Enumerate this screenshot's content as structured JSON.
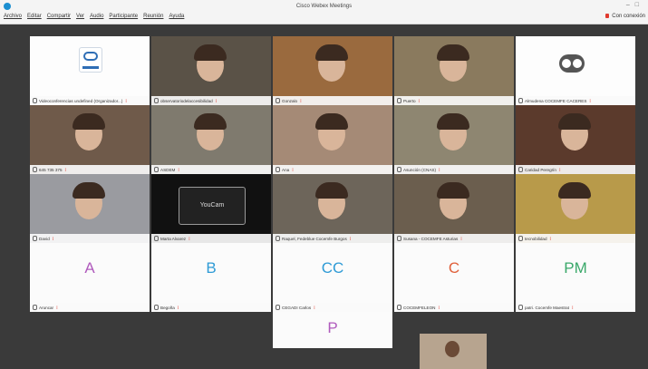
{
  "window": {
    "title": "Cisco Webex Meetings",
    "connection": "Con conexión"
  },
  "menu": [
    "Archivo",
    "Editar",
    "Compartir",
    "Ver",
    "Audio",
    "Participante",
    "Reunión",
    "Ayuda"
  ],
  "participants": [
    {
      "name": "Videoconferencias undefined (Organizador...)",
      "type": "logo"
    },
    {
      "name": "observatoriodelaccesibilidad",
      "type": "video",
      "bg": "#5a5247"
    },
    {
      "name": "Gonzalo",
      "type": "video",
      "bg": "#9a6a3e"
    },
    {
      "name": "Puerto",
      "type": "video",
      "bg": "#8a7a5e"
    },
    {
      "name": "Almudena COCEMFE CACERES",
      "type": "toggle"
    },
    {
      "name": "645 735 375",
      "type": "video",
      "bg": "#6f5a4a"
    },
    {
      "name": "ASDEM",
      "type": "video",
      "bg": "#7f7a6e"
    },
    {
      "name": "Ana",
      "type": "video",
      "bg": "#a58a76"
    },
    {
      "name": "Asunción (CNAS)",
      "type": "video",
      "bg": "#8e8671"
    },
    {
      "name": "Caridad Peregrín",
      "type": "video",
      "bg": "#5b3a2c"
    },
    {
      "name": "David",
      "type": "video",
      "bg": "#9a9ba0"
    },
    {
      "name": "Marta Alvarez",
      "type": "youcam",
      "bg": "#111111"
    },
    {
      "name": "Raquel, Fedeblue Cocemfe Burgos",
      "type": "video",
      "bg": "#6d655a"
    },
    {
      "name": "Susana - COCEMFE Asturias",
      "type": "video",
      "bg": "#6b5e4e"
    },
    {
      "name": "tecnobilidad",
      "type": "video",
      "bg": "#b89a4a"
    },
    {
      "name": "Aruncar",
      "type": "avatar",
      "initial": "A",
      "color": "#b05bbd"
    },
    {
      "name": "Begoña",
      "type": "avatar",
      "initial": "B",
      "color": "#2f9bd6"
    },
    {
      "name": "CEGADI Carlos",
      "type": "avatar",
      "initial": "CC",
      "color": "#2f9bd6"
    },
    {
      "name": "COCEMFELEON",
      "type": "avatar",
      "initial": "C",
      "color": "#e0603a"
    },
    {
      "name": "patri. Cocemfe Maestrat",
      "type": "avatar",
      "initial": "PM",
      "color": "#3aa86a"
    },
    {
      "name": "",
      "type": "avatar",
      "initial": "P",
      "color": "#b05bbd"
    }
  ],
  "youcam_label": "YouCam",
  "colors": {
    "stage": "#3a3a3a",
    "muted": "#e03a2f",
    "accent": "#1c8fd1"
  }
}
